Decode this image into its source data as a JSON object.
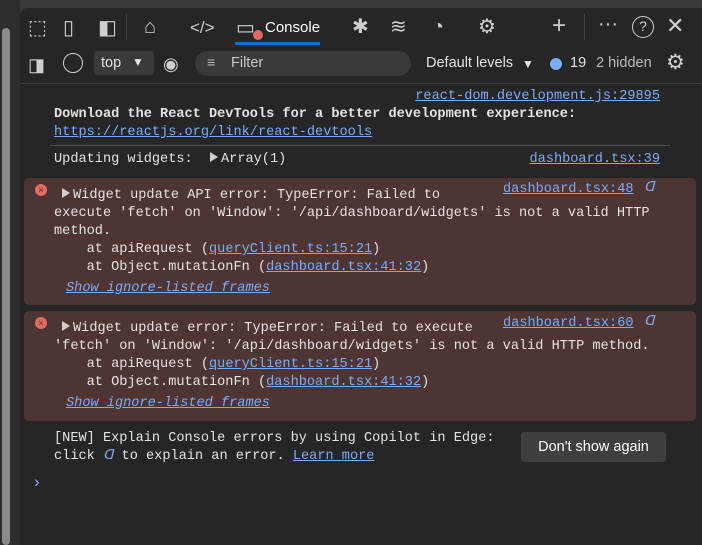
{
  "tabs": {
    "active_label": "Console",
    "icons": [
      "inspect-icon",
      "device-emulation-icon",
      "sidebar-toggle-icon",
      "home-icon",
      "elements-icon",
      "console-icon",
      "sources-bug-icon",
      "network-wifi-icon",
      "performance-gauge-icon",
      "memory-chip-icon",
      "add-tab-icon",
      "more-icon",
      "help-icon",
      "close-icon"
    ]
  },
  "toolbar": {
    "context": "top",
    "filter_placeholder": "Filter",
    "levels": "Default levels",
    "message_count": "19",
    "hidden": "2 hidden"
  },
  "console": {
    "msg1": {
      "source": "react-dom.development.js:29895",
      "text": "Download the React DevTools for a better development experience:",
      "link": "https://reactjs.org/link/react-devtools"
    },
    "msg2": {
      "text": "Updating widgets: ",
      "object": "Array(1)",
      "source": "dashboard.tsx:39"
    },
    "err1": {
      "line1": "Widget update API error: TypeError: Failed to",
      "line2": "execute 'fetch' on 'Window': '/api/dashboard/widgets' is not a valid HTTP",
      "line3": "method.",
      "at1": "    at apiRequest (",
      "at1_link": "queryClient.ts:15:21",
      "at2": "    at Object.mutationFn (",
      "at2_link": "dashboard.tsx:41:32",
      "close": ")",
      "frames": "Show ignore-listed frames",
      "source": "dashboard.tsx:48"
    },
    "err2": {
      "line1": "Widget update error: TypeError: Failed to execute",
      "line2": "'fetch' on 'Window': '/api/dashboard/widgets' is not a valid HTTP method.",
      "at1": "    at apiRequest (",
      "at1_link": "queryClient.ts:15:21",
      "at2": "    at Object.mutationFn (",
      "at2_link": "dashboard.tsx:41:32",
      "close": ")",
      "frames": "Show ignore-listed frames",
      "source": "dashboard.tsx:60"
    },
    "tip": {
      "line1": "[NEW] Explain Console errors by using Copilot in Edge:",
      "line2a": "click ",
      "line2b": " to explain an error. ",
      "learn": "Learn more",
      "button": "Don't show again"
    }
  },
  "colors": {
    "accent": "#0b6ed1",
    "link": "#7cacf8",
    "error_bg": "#4e3534",
    "error_icon": "#e46962"
  }
}
